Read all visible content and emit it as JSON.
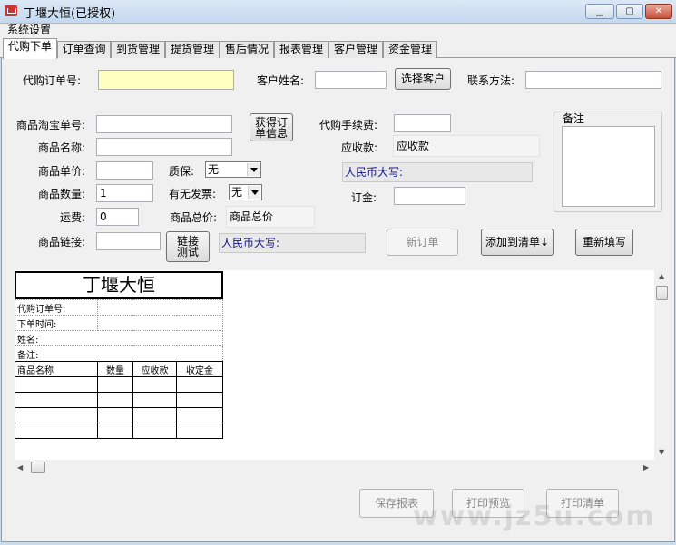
{
  "window": {
    "title": "丁堰大恒(已授权)",
    "minimize": "▁",
    "maximize": "▢",
    "close": "✕"
  },
  "menu": {
    "system": "系统设置"
  },
  "tabs": [
    "代购下单",
    "订单查询",
    "到货管理",
    "提货管理",
    "售后情况",
    "报表管理",
    "客户管理",
    "资金管理"
  ],
  "form": {
    "order_no_label": "代购订单号:",
    "order_no_value": "",
    "customer_name_label": "客户姓名:",
    "customer_name_value": "",
    "select_customer_button": "选择客户",
    "contact_label": "联系方法:",
    "contact_value": "",
    "taobao_no_label": "商品淘宝单号:",
    "taobao_no_value": "",
    "get_order_info_button_line1": "获得订",
    "get_order_info_button_line2": "单信息",
    "product_name_label": "商品名称:",
    "product_name_value": "",
    "unit_price_label": "商品单价:",
    "unit_price_value": "",
    "warranty_label": "质保:",
    "warranty_value": "无",
    "quantity_label": "商品数量:",
    "quantity_value": "1",
    "invoice_label": "有无发票:",
    "invoice_value": "无",
    "shipping_label": "运费:",
    "shipping_value": "0",
    "total_price_label": "商品总价:",
    "total_price_value": "商品总价",
    "link_label": "商品链接:",
    "link_value": "",
    "link_test_button_line1": "链接",
    "link_test_button_line2": "测试",
    "rmb_upper_label_left": "人民币大写:",
    "service_fee_label": "代购手续费:",
    "service_fee_value": "",
    "receivable_label": "应收款:",
    "receivable_value": "应收款",
    "rmb_upper_label_right": "人民币大写:",
    "deposit_label": "订金:",
    "deposit_value": "",
    "remark_label": "备注",
    "remark_value": "",
    "new_order_button": "新订单",
    "add_to_list_button": "添加到清单↓",
    "reset_button": "重新填写"
  },
  "receipt": {
    "title": "丁堰大恒",
    "order_no": "代购订单号:",
    "order_time": "下单时间:",
    "name": "姓名:",
    "remark": "备注:",
    "columns": [
      "商品名称",
      "数量",
      "应收款",
      "收定金"
    ]
  },
  "footer": {
    "save_report": "保存报表",
    "print_preview": "打印预览",
    "print_list": "打印清单",
    "watermark": "www.jz5u.com"
  },
  "colors": {
    "highlight_input": "#ffffc0",
    "rmb_text": "#10108a"
  }
}
